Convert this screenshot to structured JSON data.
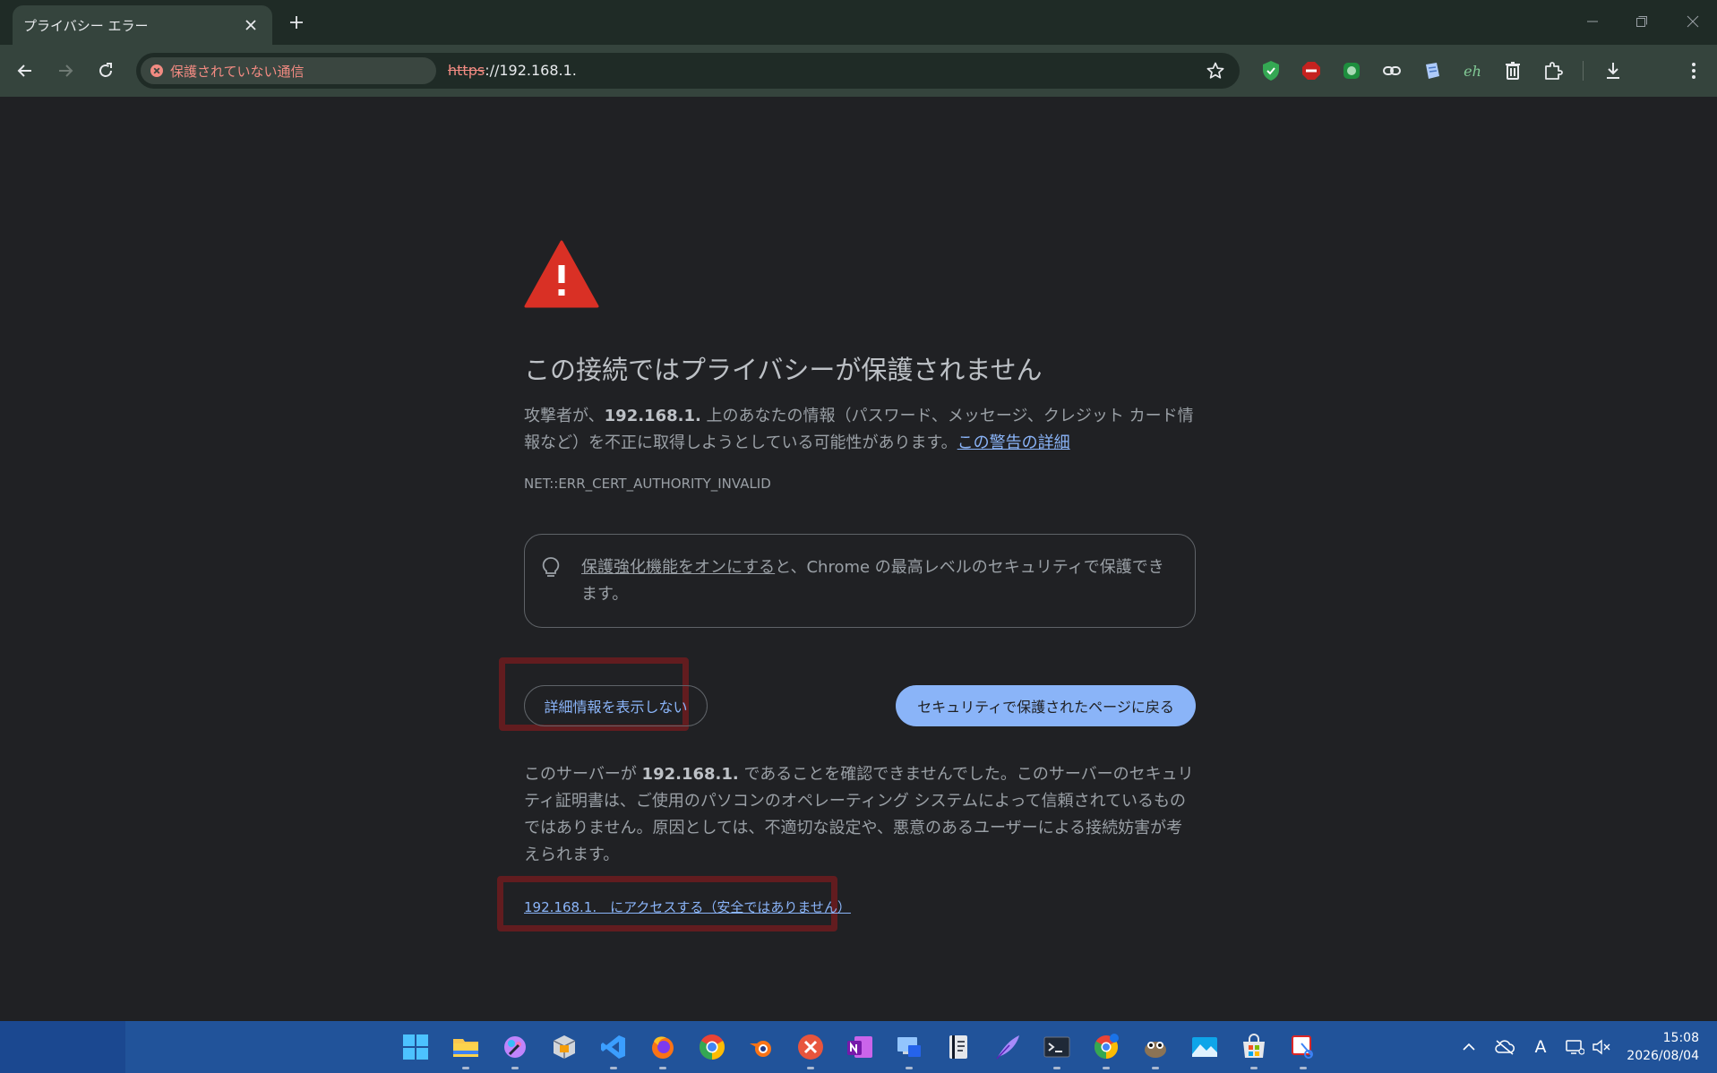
{
  "tab": {
    "title": "プライバシー エラー"
  },
  "toolbar": {
    "security_chip": "保護されていない通信",
    "url_scheme": "https",
    "url_rest": "://192.168.1."
  },
  "extensions": [
    "shield-check-icon",
    "block-icon",
    "robot-icon",
    "link-icon",
    "page-icon",
    "eh-icon",
    "trash-icon",
    "puzzle-icon",
    "download-icon",
    "kebab-menu-icon"
  ],
  "extension_text": {
    "eh": "eh"
  },
  "content": {
    "heading": "この接続ではプライバシーが保護されません",
    "p1_prefix": "攻撃者が、",
    "p1_host": "192.168.1.",
    "p1_suffix": " 上のあなたの情報（パスワード、メッセージ、クレジット カード情報など）を不正に取得しようとしている可能性があります。",
    "p1_link": "この警告の詳細",
    "error_code": "NET::ERR_CERT_AUTHORITY_INVALID",
    "tip_link": "保護強化機能をオンにする",
    "tip_rest": "と、Chrome の最高レベルのセキュリティで保護できます。",
    "details_button": "詳細情報を表示しない",
    "back_button": "セキュリティで保護されたページに戻る",
    "p3_prefix": "このサーバーが ",
    "p3_host": "192.168.1.",
    "p3_suffix": " であることを確認できませんでした。このサーバーのセキュリティ証明書は、ご使用のパソコンのオペレーティング システムによって信頼されているものではありません。原因としては、不適切な設定や、悪意のあるユーザーによる接続妨害が考えられます。",
    "proceed_link": "192.168.1.　にアクセスする（安全ではありません）"
  },
  "colors": {
    "accent": "#8ab4f8",
    "warning_red": "#d93025",
    "highlight_box": "#621c1f",
    "taskbar": "#21539a"
  },
  "taskbar": {
    "apps": [
      "windows-start-icon",
      "file-explorer-icon",
      "paint-icon",
      "package-icon",
      "vscode-icon",
      "firefox-icon",
      "chrome-icon",
      "blender-icon",
      "xmind-icon",
      "onenote-icon",
      "remote-desktop-icon",
      "notebook-icon",
      "quill-icon",
      "terminal-icon",
      "chrome-beta-icon",
      "gimp-icon",
      "photos-icon",
      "store-icon",
      "snipping-tool-icon"
    ],
    "time": "15:08",
    "date": "2026/08/04",
    "ime": "A"
  }
}
